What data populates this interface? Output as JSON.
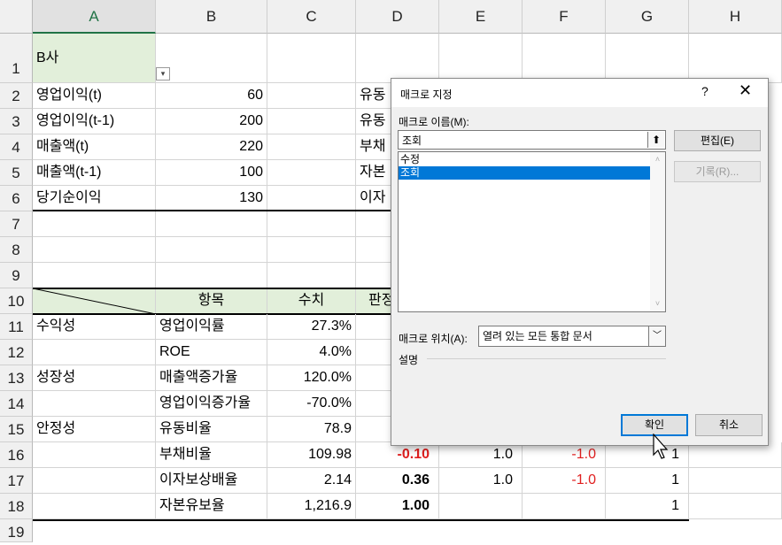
{
  "columns": [
    "A",
    "B",
    "C",
    "D",
    "E",
    "F",
    "G",
    "H"
  ],
  "rows": [
    "1",
    "2",
    "3",
    "4",
    "5",
    "6",
    "7",
    "8",
    "9",
    "10",
    "11",
    "12",
    "13",
    "14",
    "15",
    "16",
    "17",
    "18",
    "19"
  ],
  "cells": {
    "A1": "B사",
    "A2": "영업이익(t)",
    "B2": "60",
    "D2": "유동",
    "A3": "영업이익(t-1)",
    "B3": "200",
    "D3": "유동",
    "A4": "매출액(t)",
    "B4": "220",
    "D4": "부채",
    "A5": "매출액(t-1)",
    "B5": "100",
    "D5": "자본",
    "A6": "당기순이익",
    "B6": "130",
    "D6": "이자",
    "B10": "항목",
    "C10": "수치",
    "D10": "판정",
    "A11": "수익성",
    "B11": "영업이익률",
    "C11": "27.3%",
    "B12": "ROE",
    "C12": "4.0%",
    "A13": "성장성",
    "B13": "매출액증가율",
    "C13": "120.0%",
    "B14": "영업이익증가율",
    "C14": "-70.0%",
    "A15": "안정성",
    "B15": "유동비율",
    "C15": "78.9",
    "B16": "부채비율",
    "C16": "109.98",
    "D16": "-0.10",
    "E16": "1.0",
    "F16": "-1.0",
    "G16": "1",
    "B17": "이자보상배율",
    "C17": "2.14",
    "D17": "0.36",
    "E17": "1.0",
    "F17": "-1.0",
    "G17": "1",
    "B18": "자본유보율",
    "C18": "1,216.9",
    "D18": "1.00",
    "G18": "1"
  },
  "dialog": {
    "title": "매크로 지정",
    "help": "?",
    "close": "✕",
    "name_label": "매크로 이름(M):",
    "name_value": "조회",
    "macros": [
      "수정",
      "조회"
    ],
    "selected_macro": "조회",
    "edit_button": "편집(E)",
    "record_button": "기록(R)...",
    "location_label": "매크로 위치(A):",
    "location_value": "열려 있는 모든 통합 문서",
    "description_label": "설명",
    "ok_button": "확인",
    "cancel_button": "취소"
  }
}
